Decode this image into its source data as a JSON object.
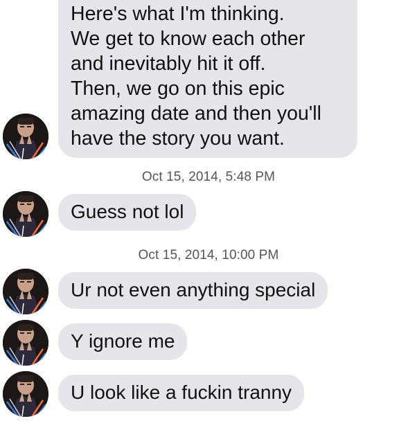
{
  "messages": [
    {
      "lines": [
        "Here's what I'm thinking.",
        "We get to know each other",
        "and inevitably hit it off.",
        "Then, we go on this epic",
        "amazing date and then you'll",
        "have the story you want."
      ]
    },
    {
      "timestamp": "Oct 15, 2014, 5:48 PM"
    },
    {
      "text": "Guess not lol"
    },
    {
      "timestamp": "Oct 15, 2014, 10:00 PM"
    },
    {
      "text": "Ur not even anything special"
    },
    {
      "text": "Y ignore me"
    },
    {
      "text": "U look like a fuckin tranny"
    }
  ],
  "colors": {
    "bubble_bg": "#e6e6ea",
    "text": "#111111",
    "timestamp": "#555558",
    "background": "#ffffff"
  },
  "icons": {
    "sender_avatar": "profile-photo-icon"
  }
}
